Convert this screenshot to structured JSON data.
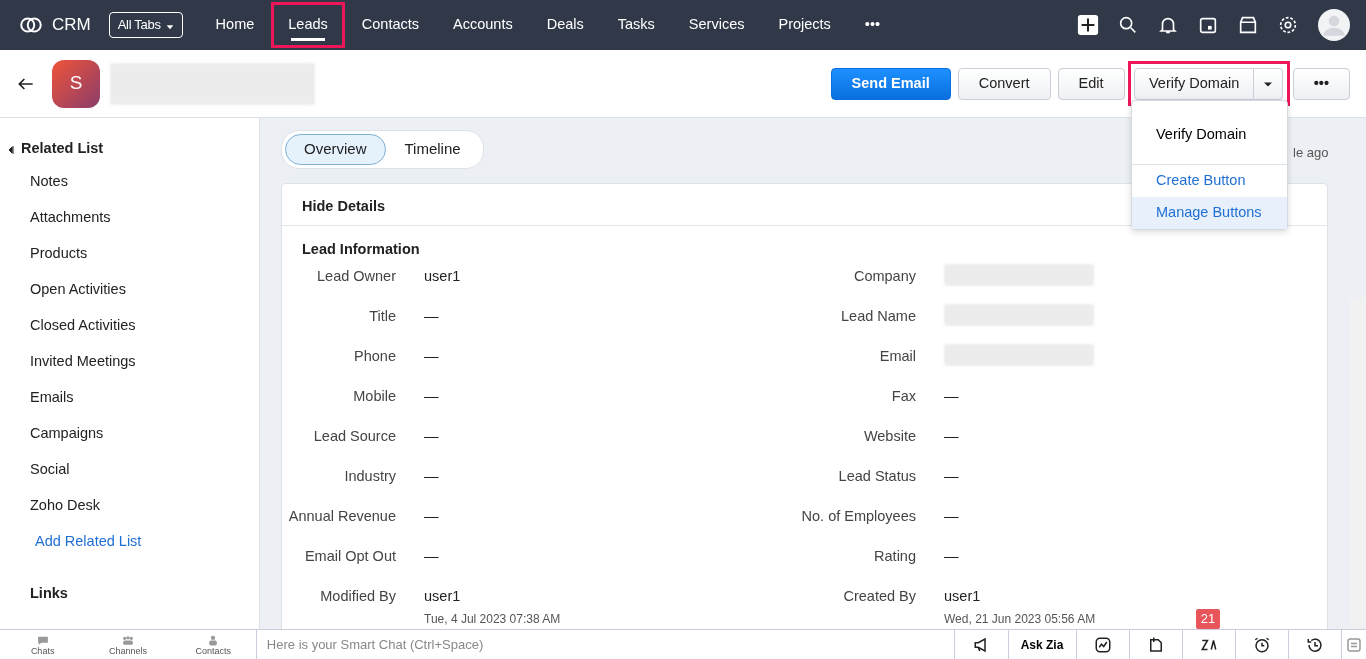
{
  "topbar": {
    "logo": "CRM",
    "all_tabs": "All Tabs",
    "tabs": [
      {
        "label": "Home",
        "selected": false,
        "highlighted": false
      },
      {
        "label": "Leads",
        "selected": true,
        "highlighted": true
      },
      {
        "label": "Contacts",
        "selected": false,
        "highlighted": false
      },
      {
        "label": "Accounts",
        "selected": false,
        "highlighted": false
      },
      {
        "label": "Deals",
        "selected": false,
        "highlighted": false
      },
      {
        "label": "Tasks",
        "selected": false,
        "highlighted": false
      },
      {
        "label": "Services",
        "selected": false,
        "highlighted": false
      },
      {
        "label": "Projects",
        "selected": false,
        "highlighted": false
      }
    ],
    "more": "•••"
  },
  "record": {
    "avatar": "S",
    "actions": [
      {
        "kind": "primary",
        "label": "Send Email"
      },
      {
        "kind": "plain",
        "label": "Convert"
      },
      {
        "kind": "plain",
        "label": "Edit"
      },
      {
        "kind": "split",
        "label": "Verify Domain",
        "highlighted": true
      },
      {
        "kind": "more",
        "label": "•••"
      }
    ],
    "menu": {
      "items": [
        {
          "kind": "action",
          "label": "Verify Domain",
          "hovered": false
        },
        {
          "kind": "link",
          "label": "Create Button",
          "hovered": false
        },
        {
          "kind": "link",
          "label": "Manage Buttons",
          "hovered": true
        }
      ]
    }
  },
  "sidebar": {
    "title": "Related List",
    "items": [
      "Notes",
      "Attachments",
      "Products",
      "Open Activities",
      "Closed Activities",
      "Invited Meetings",
      "Emails",
      "Campaigns",
      "Social",
      "Zoho Desk"
    ],
    "add_link": "Add Related List",
    "links_title": "Links"
  },
  "view_tabs": [
    {
      "label": "Overview",
      "selected": true
    },
    {
      "label": "Timeline",
      "selected": false
    }
  ],
  "modified_note": "le ago",
  "details": {
    "toggle": "Hide Details",
    "section": "Lead Information",
    "rows": [
      {
        "left": {
          "label": "Lead Owner",
          "value": "user1"
        },
        "right": {
          "label": "Company"
        }
      },
      {
        "left": {
          "label": "Title",
          "value": "—"
        },
        "right": {
          "label": "Lead Name"
        }
      },
      {
        "left": {
          "label": "Phone",
          "value": "—"
        },
        "right": {
          "label": "Email"
        }
      },
      {
        "left": {
          "label": "Mobile",
          "value": "—"
        },
        "right": {
          "label": "Fax",
          "value": "—"
        }
      },
      {
        "left": {
          "label": "Lead Source",
          "value": "—"
        },
        "right": {
          "label": "Website",
          "value": "—"
        }
      },
      {
        "left": {
          "label": "Industry",
          "value": "—"
        },
        "right": {
          "label": "Lead Status",
          "value": "—"
        }
      },
      {
        "left": {
          "label": "Annual Revenue",
          "value": "—"
        },
        "right": {
          "label": "No. of Employees",
          "value": "—"
        }
      },
      {
        "left": {
          "label": "Email Opt Out",
          "value": "—"
        },
        "right": {
          "label": "Rating",
          "value": "—"
        }
      },
      {
        "left": {
          "label": "Modified By",
          "value": "user1",
          "sub": "Tue, 4 Jul 2023 07:38 AM"
        },
        "right": {
          "label": "Created By",
          "value": "user1",
          "sub": "Wed, 21 Jun 2023 05:56 AM"
        }
      }
    ]
  },
  "bottom_bar": {
    "shortcuts": [
      "Chats",
      "Channels",
      "Contacts"
    ],
    "chat_placeholder": "Here is your Smart Chat (Ctrl+Space)",
    "ask_zia": "Ask Zia",
    "badge": "21"
  }
}
